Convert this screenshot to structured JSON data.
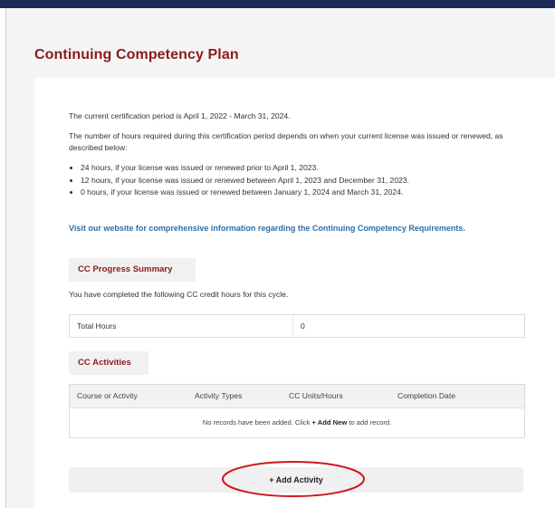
{
  "header": {
    "title": "Continuing Competency Plan"
  },
  "intro": {
    "period_text": "The current certification period is April 1, 2022 - March 31, 2024.",
    "hours_text": "The number of hours required during this certification period depends on when your current license was issued or renewed, as described below:",
    "bullets": [
      "24 hours, if your license was issued or renewed prior to April 1, 2023.",
      "12 hours, if your license was issued or renewed between April 1, 2023 and December 31, 2023.",
      "0 hours, if your license was issued or renewed between January 1, 2024 and March 31, 2024."
    ]
  },
  "link_text": "Visit our website for comprehensive information regarding the Continuing Competency Requirements.",
  "progress": {
    "section_label": "CC Progress Summary",
    "note": "You have completed the following CC credit hours for this cycle.",
    "total_label": "Total Hours",
    "total_value": "0"
  },
  "activities": {
    "section_label": "CC Activities",
    "columns": [
      "Course or Activity",
      "Activity Types",
      "CC Units/Hours",
      "Completion Date"
    ],
    "empty_prefix": "No records have been added. Click ",
    "empty_action": "+ Add New",
    "empty_suffix": " to add record.",
    "add_button": "+ Add Activity"
  },
  "colors": {
    "top_bar": "#1d2a55",
    "title": "#8b1a1a",
    "link": "#2f6ea6",
    "highlight_oval": "#d0181c"
  },
  "icons": {
    "highlight": "red-oval-annotation"
  }
}
